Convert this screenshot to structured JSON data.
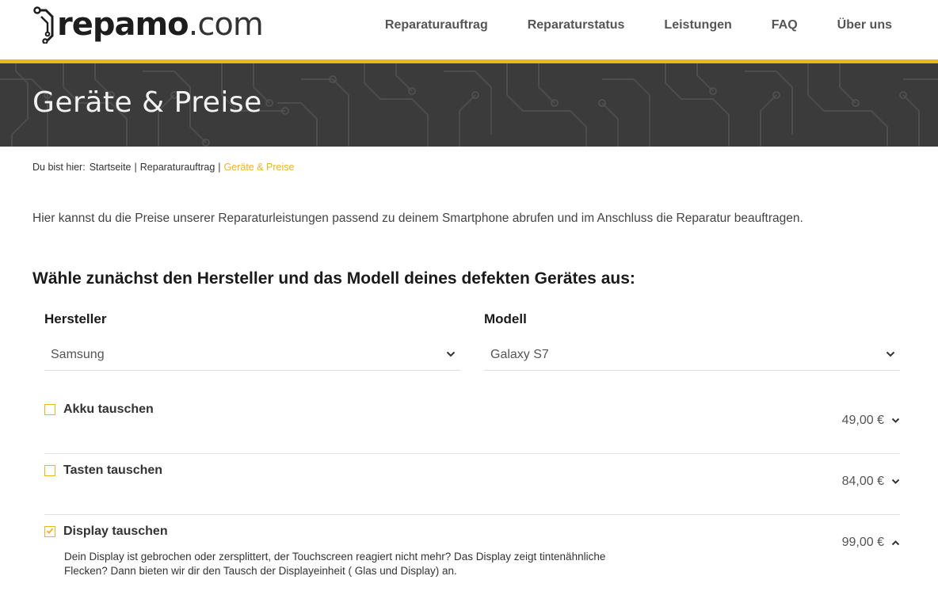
{
  "header": {
    "logo": {
      "bold": "repamo",
      "light": ".com"
    },
    "nav": [
      {
        "label": "Reparaturauftrag"
      },
      {
        "label": "Reparaturstatus"
      },
      {
        "label": "Leistungen"
      },
      {
        "label": "FAQ"
      },
      {
        "label": "Über uns"
      }
    ]
  },
  "hero": {
    "title": "Geräte & Preise"
  },
  "breadcrumb": {
    "prefix": "Du bist hier:",
    "items": [
      "Startseite",
      "Reparaturauftrag",
      "Geräte & Preise"
    ]
  },
  "intro": "Hier kannst du die Preise unserer Reparaturleistungen passend zu deinem Smartphone abrufen und im Anschluss die Reparatur beauftragen.",
  "section_title": "Wähle zunächst den Hersteller und das Modell deines defekten Gerätes aus:",
  "manufacturer": {
    "label": "Hersteller",
    "value": "Samsung"
  },
  "model": {
    "label": "Modell",
    "value": "Galaxy S7"
  },
  "services": [
    {
      "name": "Akku tauschen",
      "price": "49,00 €",
      "checked": false,
      "expanded": false
    },
    {
      "name": "Tasten tauschen",
      "price": "84,00 €",
      "checked": false,
      "expanded": false
    },
    {
      "name": "Display tauschen",
      "price": "99,00 €",
      "checked": true,
      "expanded": true,
      "description_line1": "Dein Display ist gebrochen oder zersplittert, der Touchscreen reagiert nicht mehr? Das Display zeigt tintenähnliche",
      "description_line2": "Flecken? Dann bieten wir dir den Tausch der Displayeinheit ( Glas und Display) an."
    }
  ],
  "colors": {
    "accent": "#f0b41c",
    "hero_bg": "#3b3b3b",
    "text": "#222222"
  },
  "icons": {
    "select_chevron": "chevron-down-icon",
    "collapsed": "chevron-down-icon",
    "expanded": "chevron-up-icon",
    "checkbox_checked": "check-icon"
  }
}
